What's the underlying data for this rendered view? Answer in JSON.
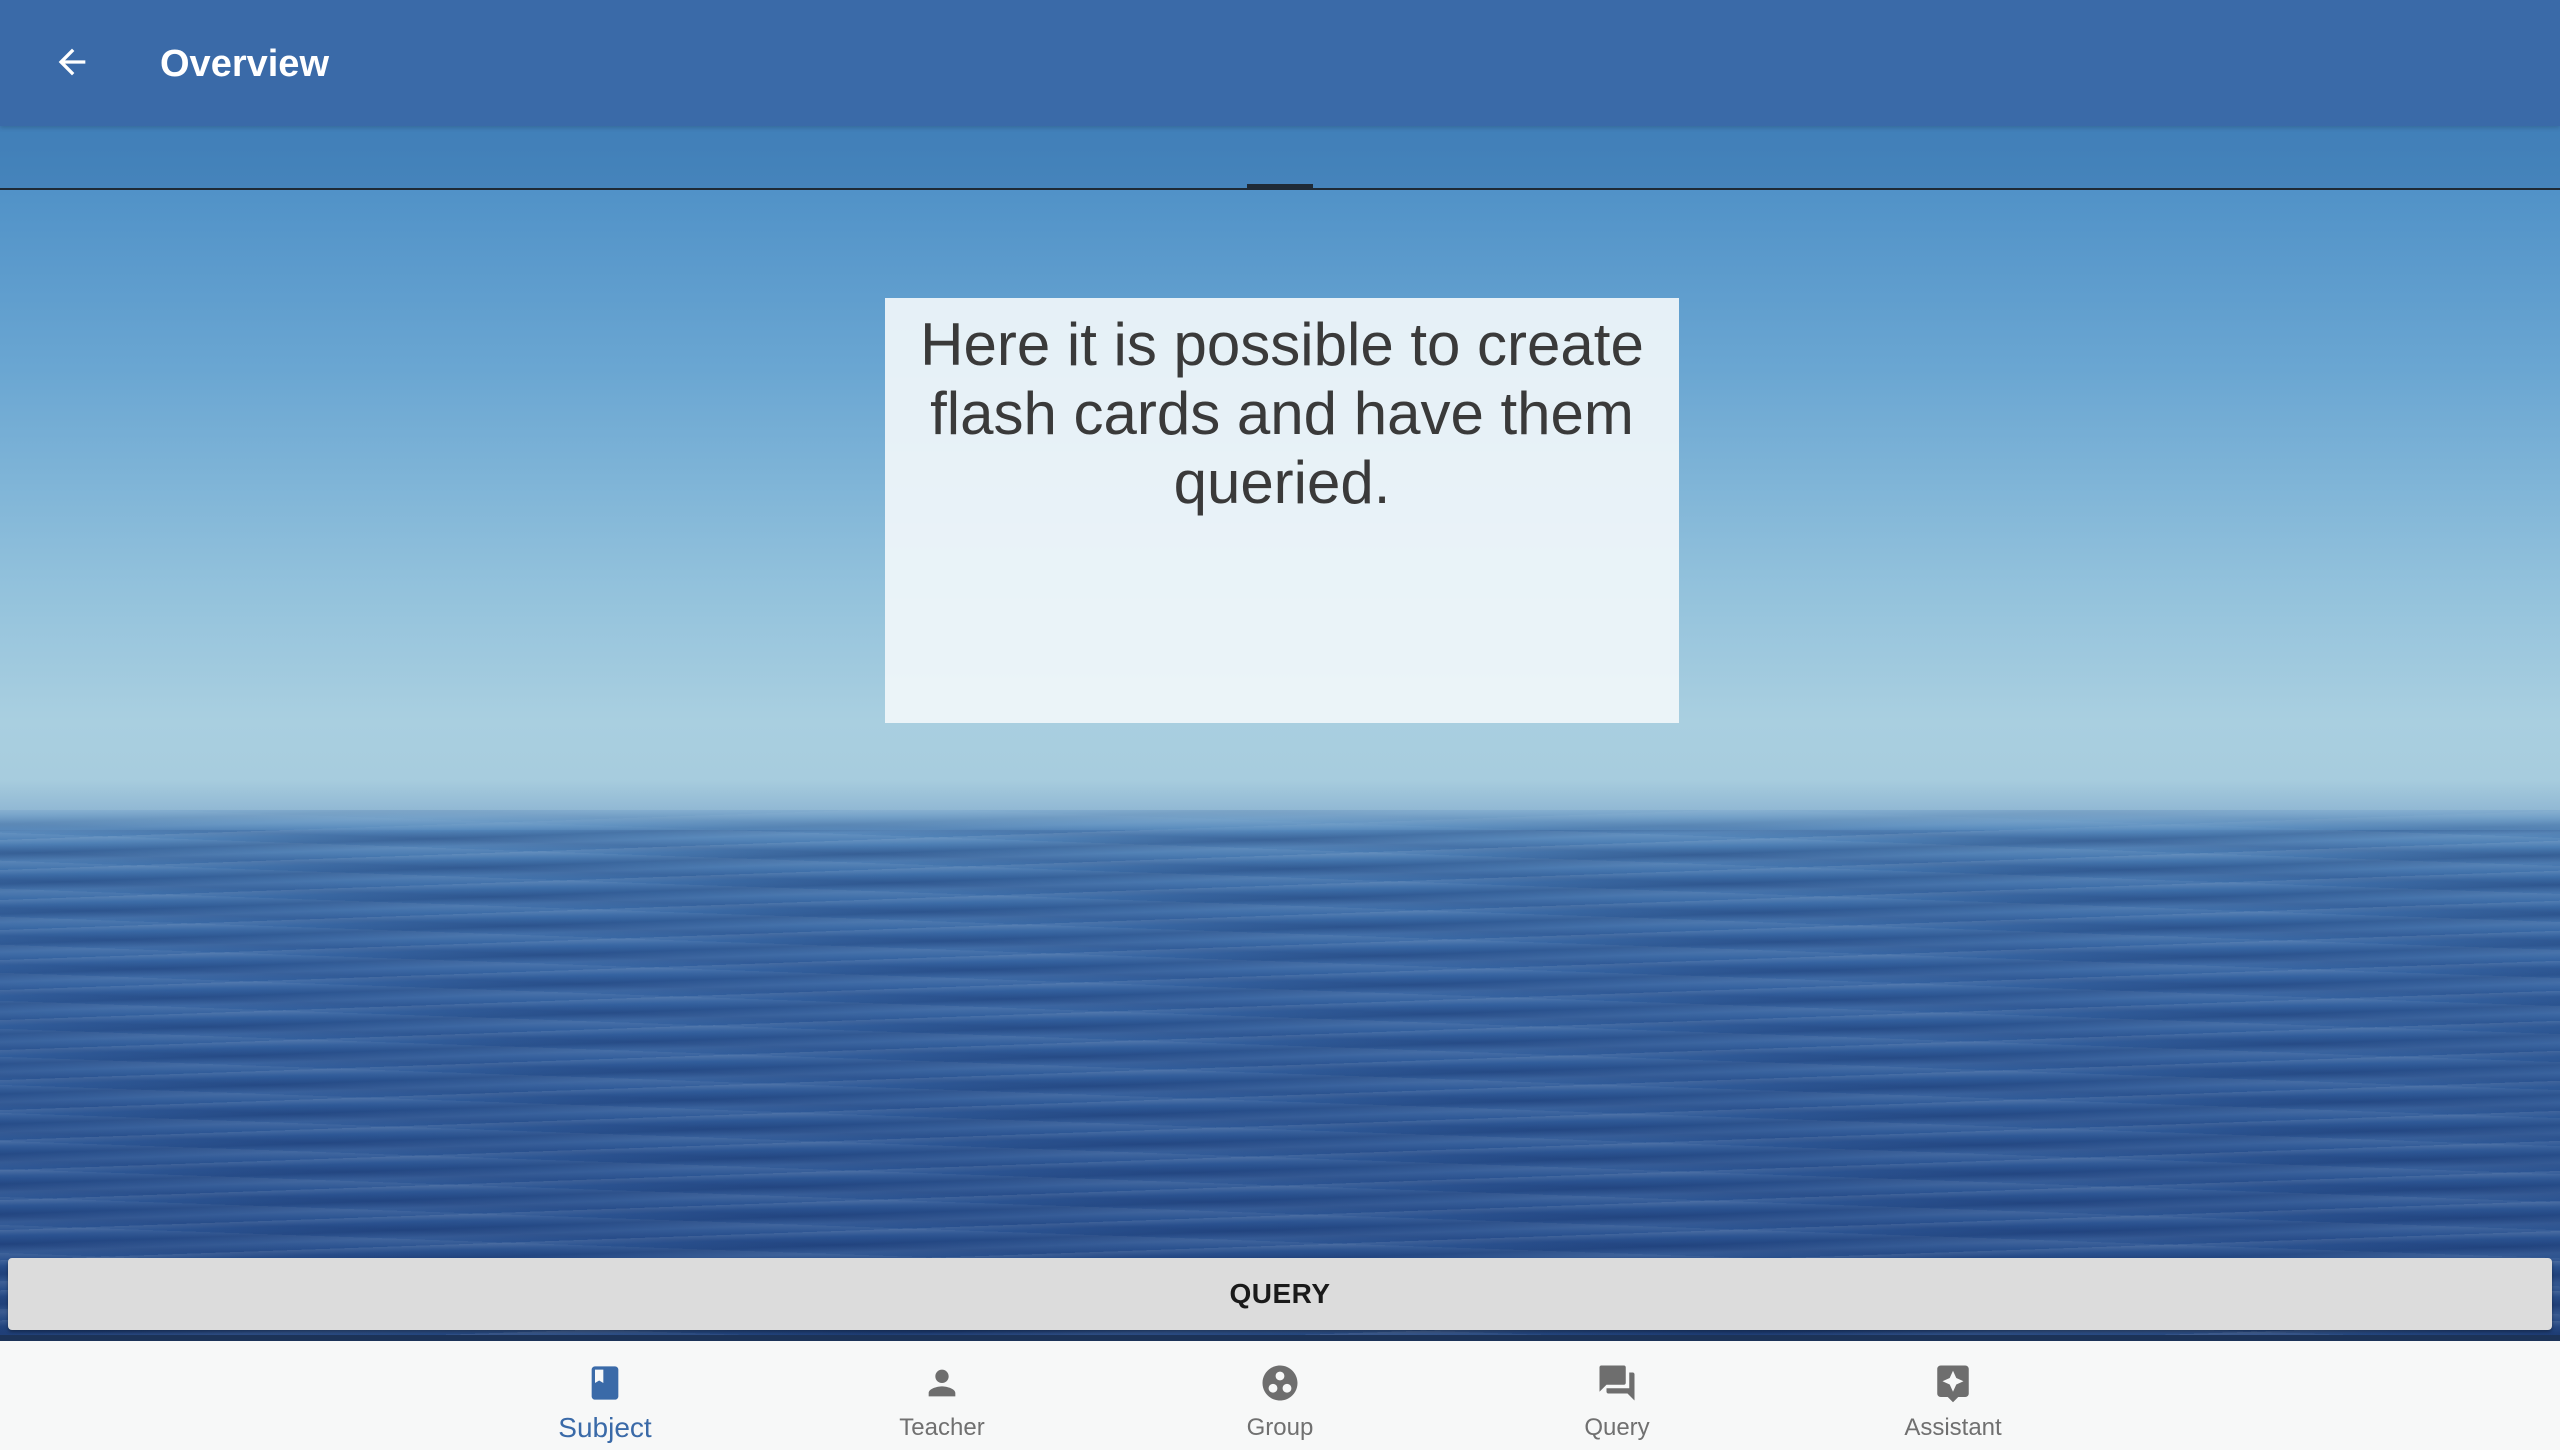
{
  "app_bar": {
    "title": "Overview",
    "back_icon": "arrow-back-icon"
  },
  "card": {
    "text": "Here it is possible to create flash cards and have them queried."
  },
  "actions": {
    "query_label": "QUERY"
  },
  "bottom_nav": {
    "active": "Subject",
    "items": [
      {
        "label": "Subject",
        "icon": "book-icon"
      },
      {
        "label": "Teacher",
        "icon": "person-icon"
      },
      {
        "label": "Group",
        "icon": "group-icon"
      },
      {
        "label": "Query",
        "icon": "chat-icon"
      },
      {
        "label": "Assistant",
        "icon": "assistant-icon"
      }
    ]
  },
  "colors": {
    "app_bar": "#3a6aa8",
    "active_nav": "#3a6aa8",
    "inactive_nav": "#707070"
  }
}
